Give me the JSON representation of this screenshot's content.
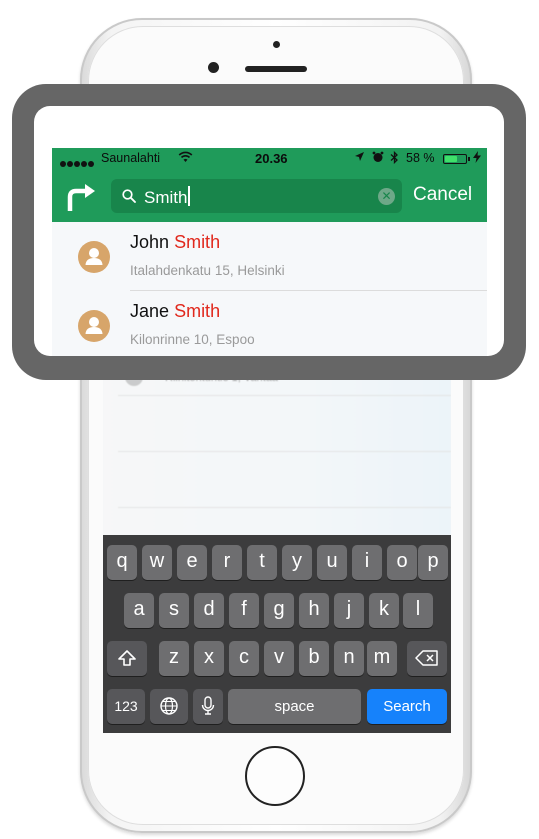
{
  "status_bar": {
    "carrier": "Saunalahti",
    "time": "20.36",
    "battery": "58 %",
    "battery_level": 0.58
  },
  "search": {
    "query": "Smith",
    "cancel_label": "Cancel"
  },
  "results": [
    {
      "first": "John",
      "last": "Smith",
      "address": "Italahdenkatu 15, Helsinki"
    },
    {
      "first": "Jane",
      "last": "Smith",
      "address": "Kilonrinne 10, Espoo"
    }
  ],
  "background_row_address": "Riihitontuntie 1, Vantaa",
  "keyboard": {
    "row1": [
      "q",
      "w",
      "e",
      "r",
      "t",
      "y",
      "u",
      "i",
      "o",
      "p"
    ],
    "row2": [
      "a",
      "s",
      "d",
      "f",
      "g",
      "h",
      "j",
      "k",
      "l"
    ],
    "row3": [
      "z",
      "x",
      "c",
      "v",
      "b",
      "n",
      "m"
    ],
    "numbers_label": "123",
    "space_label": "space",
    "search_label": "Search"
  },
  "colors": {
    "accent_green": "#1f9b5a",
    "highlight_red": "#e1281c",
    "key_blue": "#1682fb"
  }
}
